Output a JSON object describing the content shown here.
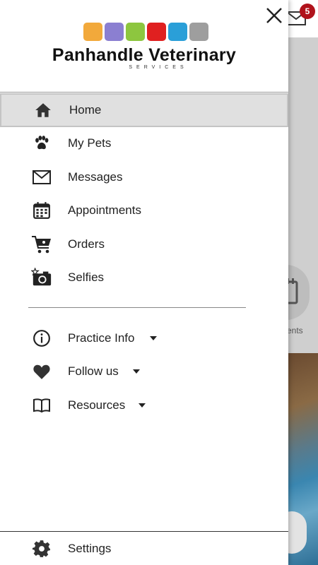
{
  "background": {
    "mail_badge_count": "5",
    "partial_label": "ments"
  },
  "logo": {
    "title": "Panhandle Veterinary",
    "subtitle": "SERVICES",
    "tile_colors": [
      "#f2a93b",
      "#8b7fd1",
      "#8dc63f",
      "#e02020",
      "#2a9fd8",
      "#9e9e9e"
    ]
  },
  "menu": {
    "items": [
      {
        "label": "Home",
        "icon": "home-icon"
      },
      {
        "label": "My Pets",
        "icon": "paw-icon"
      },
      {
        "label": "Messages",
        "icon": "mail-icon"
      },
      {
        "label": "Appointments",
        "icon": "calendar-icon"
      },
      {
        "label": "Orders",
        "icon": "cart-icon"
      },
      {
        "label": "Selfies",
        "icon": "camera-icon"
      }
    ],
    "secondary": [
      {
        "label": "Practice Info",
        "icon": "info-icon"
      },
      {
        "label": "Follow us",
        "icon": "heart-icon"
      },
      {
        "label": "Resources",
        "icon": "book-icon"
      }
    ],
    "settings_label": "Settings"
  },
  "colors": {
    "active_bg": "#e0e0e0",
    "badge": "#b0121b"
  }
}
